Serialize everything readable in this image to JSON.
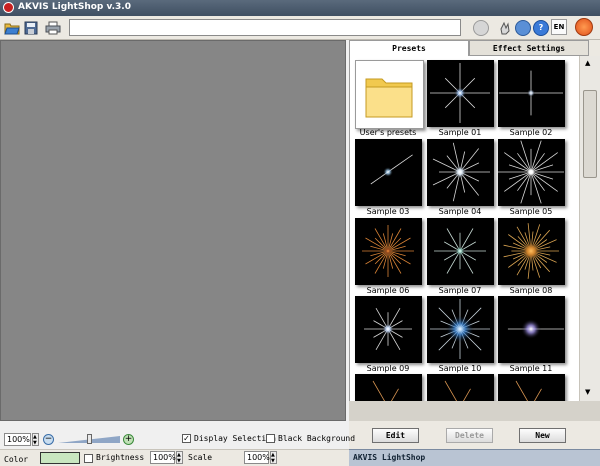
{
  "window": {
    "title": "AKVIS LightShop v.3.0"
  },
  "toolbar": {
    "open_icon": "folder-open-icon",
    "save_icon": "floppy-disk-icon",
    "print_icon": "printer-icon",
    "path_value": "",
    "language_label": "EN"
  },
  "tabs": {
    "presets_label": "Presets",
    "effects_label": "Effect Settings"
  },
  "presets": [
    {
      "label": "User's presets"
    },
    {
      "label": "Sample 01"
    },
    {
      "label": "Sample 02"
    },
    {
      "label": "Sample 03"
    },
    {
      "label": "Sample 04"
    },
    {
      "label": "Sample 05"
    },
    {
      "label": "Sample 06"
    },
    {
      "label": "Sample 07"
    },
    {
      "label": "Sample 08"
    },
    {
      "label": "Sample 09"
    },
    {
      "label": "Sample 10"
    },
    {
      "label": "Sample 11"
    }
  ],
  "preset_buttons": {
    "edit": "Edit",
    "delete": "Delete",
    "new": "New"
  },
  "info_bar": {
    "text": "AKVIS LightShop"
  },
  "zoom": {
    "value": "100%",
    "display_selection": "Display Selection",
    "display_selection_checked": true,
    "black_background": "Black Background",
    "black_background_checked": false
  },
  "bottom": {
    "color_label": "Color",
    "brightness_label": "Brightness",
    "brightness_value": "100%",
    "scale_label": "Scale",
    "scale_value": "100%"
  },
  "colors": {
    "color_swatch": "#c9e6c0",
    "accent_red": "#c82020"
  }
}
